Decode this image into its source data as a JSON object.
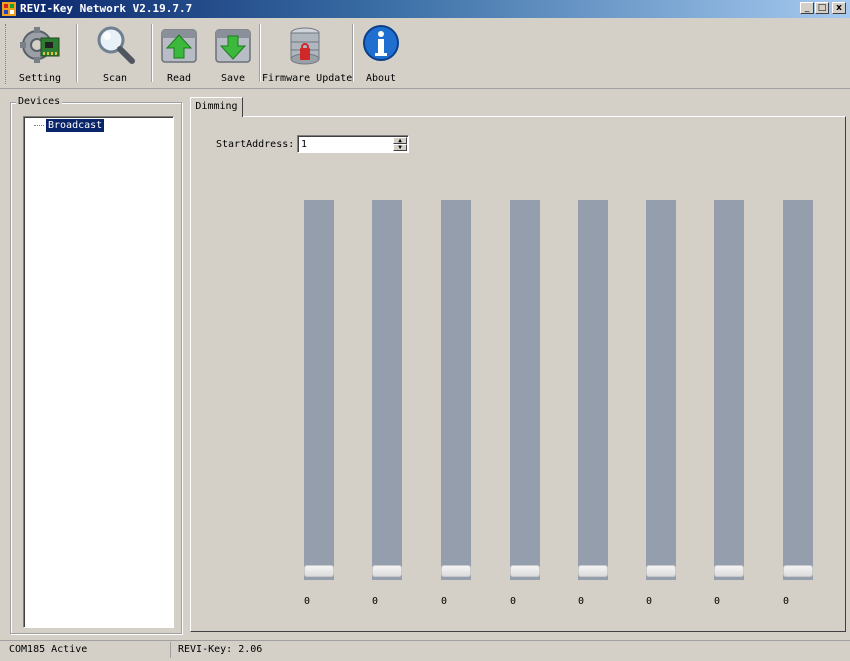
{
  "window": {
    "title": "REVI-Key Network V2.19.7.7"
  },
  "window_controls": {
    "minimize": "_",
    "maximize": "□",
    "close": "x"
  },
  "toolbar": {
    "setting_label": "Setting",
    "scan_label": "Scan",
    "read_label": "Read",
    "save_label": "Save",
    "firmware_label": "Firmware Update",
    "about_label": "About",
    "icons": [
      "gear-board-icon",
      "magnifier-icon",
      "upload-arrow-icon",
      "download-arrow-icon",
      "database-icon",
      "info-icon"
    ]
  },
  "devices": {
    "legend": "Devices",
    "tree": [
      {
        "label": "Broadcast",
        "selected": true
      }
    ]
  },
  "tabs": [
    {
      "label": "Dimming",
      "active": true
    }
  ],
  "dimming": {
    "start_address_label": "StartAddress:",
    "start_address_value": "1",
    "spin_up": "▲",
    "spin_down": "▼",
    "sliders": [
      {
        "value": "0"
      },
      {
        "value": "0"
      },
      {
        "value": "0"
      },
      {
        "value": "0"
      },
      {
        "value": "0"
      },
      {
        "value": "0"
      },
      {
        "value": "0"
      },
      {
        "value": "0"
      }
    ]
  },
  "status": {
    "port": "COM185 Active",
    "version": "REVI-Key: 2.06"
  },
  "colors": {
    "titlebar_start": "#0a246a",
    "titlebar_end": "#a6caf0",
    "face": "#d4d0c8",
    "slider_track": "#949ead",
    "selection": "#0a246a"
  }
}
